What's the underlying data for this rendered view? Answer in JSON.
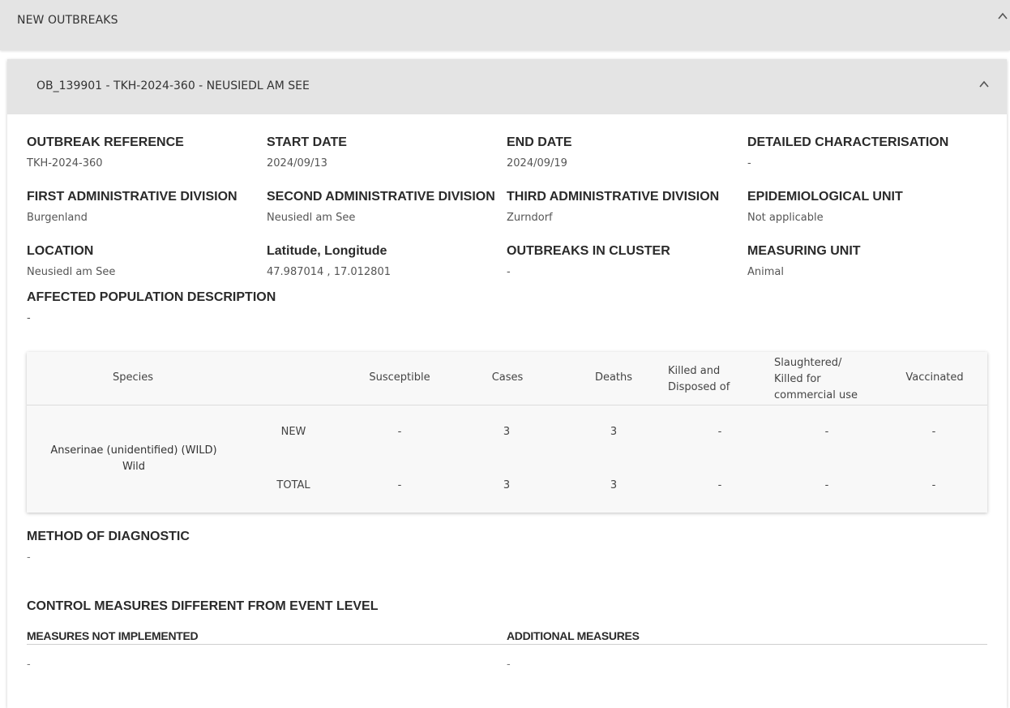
{
  "top_section": {
    "title": "NEW OUTBREAKS"
  },
  "outbreak": {
    "header": "OB_139901 - TKH-2024-360 - NEUSIEDL AM SEE",
    "fields": {
      "outbreak_reference": {
        "label": "OUTBREAK REFERENCE",
        "value": "TKH-2024-360"
      },
      "start_date": {
        "label": "START DATE",
        "value": "2024/09/13"
      },
      "end_date": {
        "label": "END DATE",
        "value": "2024/09/19"
      },
      "detailed_characterisation": {
        "label": "DETAILED CHARACTERISATION",
        "value": "-"
      },
      "first_admin_division": {
        "label": "FIRST ADMINISTRATIVE DIVISION",
        "value": "Burgenland"
      },
      "second_admin_division": {
        "label": "SECOND ADMINISTRATIVE DIVISION",
        "value": "Neusiedl am See"
      },
      "third_admin_division": {
        "label": "THIRD ADMINISTRATIVE DIVISION",
        "value": "Zurndorf"
      },
      "epidemiological_unit": {
        "label": "EPIDEMIOLOGICAL UNIT",
        "value": "Not applicable"
      },
      "location": {
        "label": "LOCATION",
        "value": "Neusiedl am See"
      },
      "lat_long": {
        "label": "Latitude, Longitude",
        "value": "47.987014 , 17.012801"
      },
      "outbreaks_in_cluster": {
        "label": "OUTBREAKS IN CLUSTER",
        "value": "-"
      },
      "measuring_unit": {
        "label": "MEASURING UNIT",
        "value": "Animal"
      },
      "affected_population": {
        "label": "AFFECTED POPULATION DESCRIPTION",
        "value": "-"
      }
    },
    "table": {
      "headers": {
        "species": "Species",
        "susceptible": "Susceptible",
        "cases": "Cases",
        "deaths": "Deaths",
        "killed_line1": "Killed and",
        "killed_line2": "Disposed of",
        "slaughtered_line1": "Slaughtered/",
        "slaughtered_line2": "Killed for",
        "slaughtered_line3": "commercial use",
        "vaccinated": "Vaccinated"
      },
      "species_line1": "Anserinae (unidentified) (WILD)",
      "species_line2": "Wild",
      "rows": [
        {
          "type": "NEW",
          "susceptible": "-",
          "cases": "3",
          "deaths": "3",
          "killed": "-",
          "slaughtered": "-",
          "vaccinated": "-"
        },
        {
          "type": "TOTAL",
          "susceptible": "-",
          "cases": "3",
          "deaths": "3",
          "killed": "-",
          "slaughtered": "-",
          "vaccinated": "-"
        }
      ]
    },
    "method_of_diagnostic": {
      "label": "METHOD OF DIAGNOSTIC",
      "value": "-"
    },
    "control_measures": {
      "title": "CONTROL MEASURES DIFFERENT FROM EVENT LEVEL",
      "not_implemented": {
        "label": "MEASURES NOT IMPLEMENTED",
        "value": "-"
      },
      "additional": {
        "label": "ADDITIONAL MEASURES",
        "value": "-"
      }
    }
  }
}
